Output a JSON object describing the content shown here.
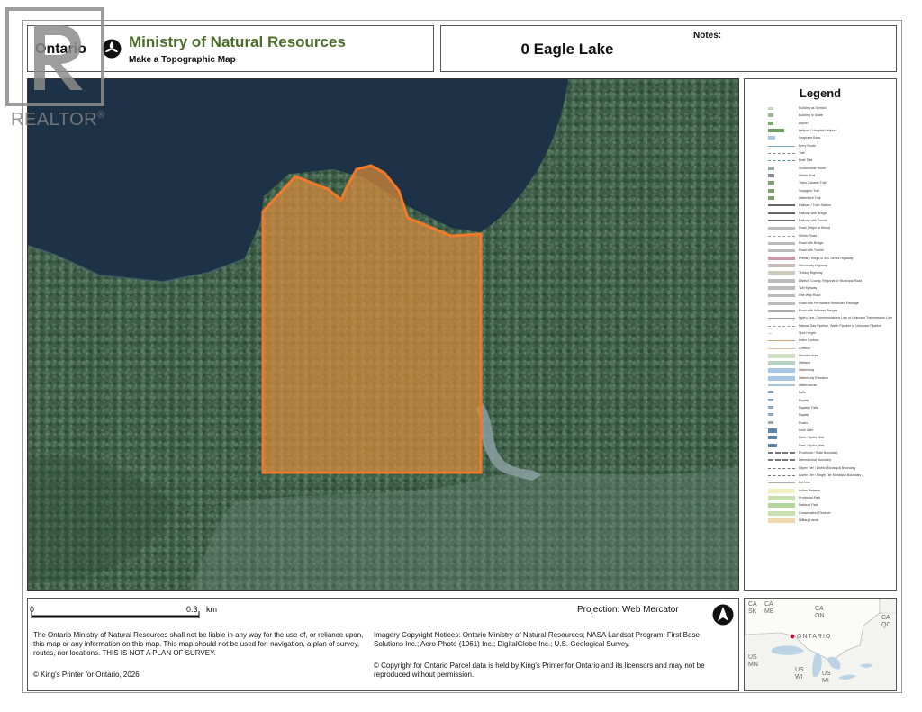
{
  "header": {
    "ontario": "Ontario",
    "ministry": "Ministry of Natural Resources",
    "subtitle": "Make a Topographic Map",
    "notes_label": "Notes:",
    "map_title": "0 Eagle Lake"
  },
  "legend": {
    "title": "Legend",
    "items": [
      "Building as Symbol",
      "Building to Scale",
      "Airport",
      "Heliport / Hospital Heliport",
      "Seaplane Base",
      "Ferry Route",
      "Trail",
      "Boat Trail",
      "Snowmobile Route",
      "Winter Trail",
      "Trans Canada Trail",
      "Voyageur Trail",
      "Waterfront Trail",
      "Railway / Train Station",
      "Railway with Bridge",
      "Railway with Tunnel",
      "Road (Major or Minor)",
      "Winter Road",
      "Road with Bridge",
      "Road with Tunnel",
      "Primary, Kings or 400 Series Highway",
      "Secondary Highway",
      "Tertiary Highway",
      "District, County, Regional or Municipal Road",
      "Toll Highway",
      "One Way Road",
      "Road with Permanent Restricted Passage",
      "Road with Address Ranges",
      "Hydro Line, Communications Line or Unknown Transmission Line",
      "Natural Gas Pipeline, Water Pipeline or Unknown Pipeline",
      "Spot Height",
      "Index Contour",
      "Contour",
      "Wooded Area",
      "Wetland",
      "Waterbody",
      "Waterbody Elevation",
      "Watercourse",
      "Falls",
      "Rapids",
      "Rapids / Falls",
      "Rapids",
      "Rocks",
      "Lock Gate",
      "Dam / Hydro Weir",
      "Dam / Hydro Weir",
      "Provincial / State Boundary",
      "International Boundary",
      "Upper Tier / District Municipal Boundary",
      "Lower Tier / Single Tier Municipal Boundary",
      "Lot Line",
      "Indian Reserve",
      "Provincial Park",
      "National Park",
      "Conservation Reserve",
      "Military Lands"
    ]
  },
  "scale": {
    "start": "0",
    "end": "0.3",
    "unit": "km"
  },
  "footer": {
    "disclaimer": "The Ontario Ministry of Natural Resources shall not be liable in any way for the use of, or reliance upon, this map or any information on this map. This map should not be used for: navigation, a plan of survey, routes, nor locations. THIS IS NOT A PLAN OF SURVEY.",
    "kings_printer": "© King's Printer for Ontario, 2026",
    "projection": "Projection: Web Mercator",
    "imagery_notice": "Imagery Copyright Notices: Ontario Ministry of Natural Resources; NASA Landsat Program; First Base Solutions Inc.; Aero-Photo (1961) Inc.; DigitalGlobe Inc.; U.S. Geological Survey.",
    "parcel_copyright": "© Copyright for Ontario Parcel data is held by King's Printer for Ontario and its licensors and may not be reproduced without permission."
  },
  "inset": {
    "labels": [
      "CA",
      "SK",
      "CA",
      "MB",
      "CA",
      "ON",
      "ONTARIO",
      "CA",
      "QC",
      "US",
      "MN",
      "US",
      "WI",
      "US",
      "MI"
    ]
  },
  "watermark": {
    "text": "REALTOR",
    "reg": "®"
  },
  "colors": {
    "ministry_green": "#4a6e2a",
    "parcel_fill": "#d98a3a",
    "parcel_outline": "#ef7a2c",
    "water": "#1d3147",
    "forest": "#3e5e48"
  }
}
